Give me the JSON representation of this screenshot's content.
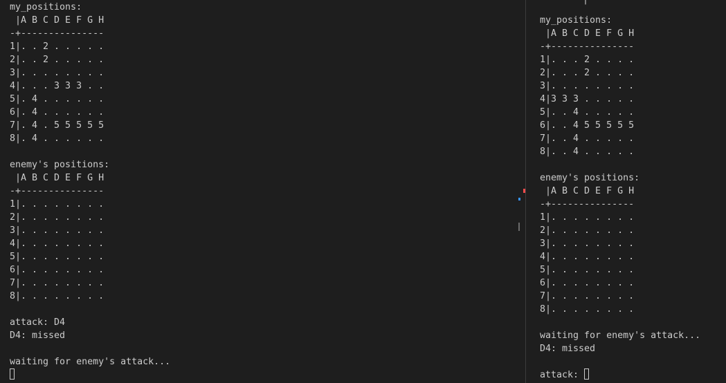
{
  "left_terminal": {
    "lines": [
      "my_positions:",
      " |A B C D E F G H",
      "-+---------------",
      "1|. . 2 . . . . .",
      "2|. . 2 . . . . .",
      "3|. . . . . . . .",
      "4|. . . 3 3 3 . .",
      "5|. 4 . . . . . .",
      "6|. 4 . . . . . .",
      "7|. 4 . 5 5 5 5 5",
      "8|. 4 . . . . . .",
      "",
      "enemy's positions:",
      " |A B C D E F G H",
      "-+---------------",
      "1|. . . . . . . .",
      "2|. . . . . . . .",
      "3|. . . . . . . .",
      "4|. . . . . . . .",
      "5|. . . . . . . .",
      "6|. . . . . . . .",
      "7|. . . . . . . .",
      "8|. . . . . . . .",
      "",
      "attack: D4",
      "D4: missed",
      "",
      "waiting for enemy's attack..."
    ],
    "prompt": ""
  },
  "right_terminal": {
    "cutoff_top": "|",
    "lines": [
      "my_positions:",
      " |A B C D E F G H",
      "-+---------------",
      "1|. . . 2 . . . .",
      "2|. . . 2 . . . .",
      "3|. . . . . . . .",
      "4|3 3 3 . . . . .",
      "5|. . 4 . . . . .",
      "6|. . 4 5 5 5 5 5",
      "7|. . 4 . . . . .",
      "8|. . 4 . . . . .",
      "",
      "enemy's positions:",
      " |A B C D E F G H",
      "-+---------------",
      "1|. . . . . . . .",
      "2|. . . . . . . .",
      "3|. . . . . . . .",
      "4|. . . . . . . .",
      "5|. . . . . . . .",
      "6|. . . . . . . .",
      "7|. . . . . . . .",
      "8|. . . . . . . .",
      "",
      "waiting for enemy's attack...",
      "D4: missed",
      ""
    ],
    "prompt": "attack: "
  },
  "colors": {
    "background": "#1e1e1e",
    "foreground": "#cccccc",
    "divider": "#3c3c3c",
    "error_marker": "#f14c4c",
    "info_marker": "#3794ff"
  }
}
